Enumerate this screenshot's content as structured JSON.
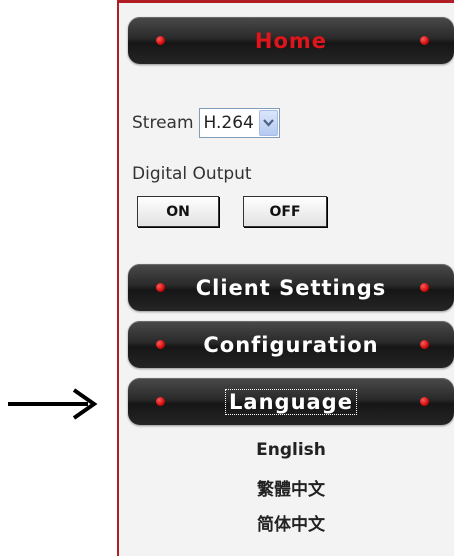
{
  "nav": {
    "home": "Home",
    "client_settings": "Client Settings",
    "configuration": "Configuration",
    "language": "Language"
  },
  "stream": {
    "label": "Stream",
    "selected": "H.264"
  },
  "digital_output": {
    "label": "Digital Output",
    "on": "ON",
    "off": "OFF"
  },
  "languages": [
    "English",
    "繁體中文",
    "简体中文"
  ],
  "icons": [
    "right-arrow-icon",
    "red-dot-icon",
    "chevron-down-icon"
  ],
  "colors": {
    "accent_red": "#e0141b",
    "panel_border": "#b11f24",
    "nav_dark": "#222222"
  }
}
